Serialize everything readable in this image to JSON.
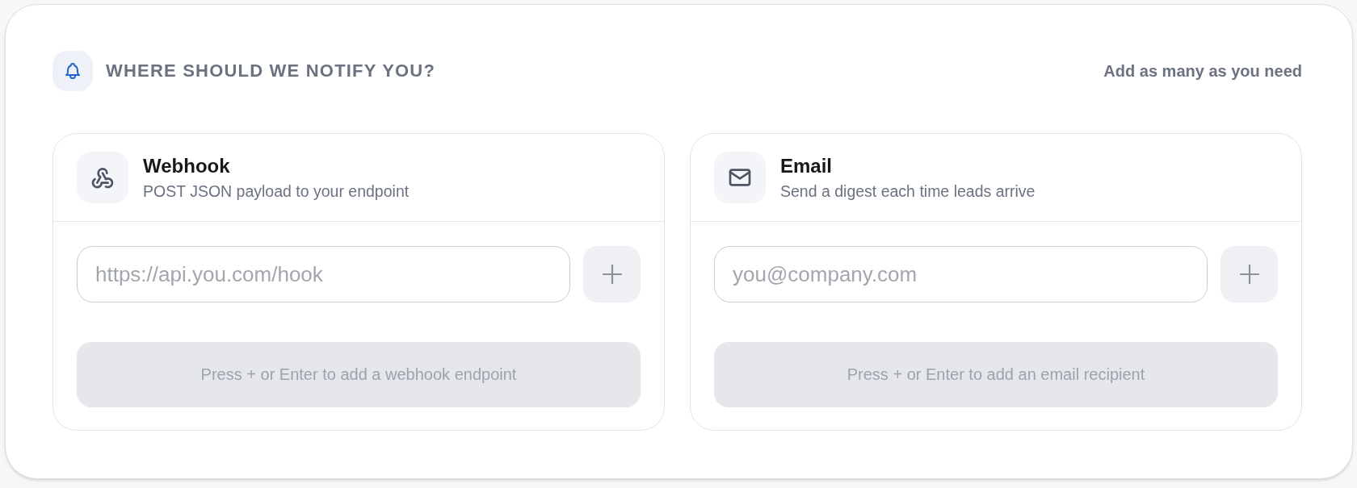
{
  "header": {
    "title": "WHERE SHOULD WE NOTIFY YOU?",
    "note": "Add as many as you need"
  },
  "channels": [
    {
      "kind": "webhook",
      "title": "Webhook",
      "subtitle": "POST JSON payload to your endpoint",
      "input": {
        "placeholder": "https://api.you.com/hook"
      },
      "empty_hint": "Press + or Enter to add a webhook endpoint"
    },
    {
      "kind": "email",
      "title": "Email",
      "subtitle": "Send a digest each time leads arrive",
      "input": {
        "placeholder": "you@company.com"
      },
      "empty_hint": "Press + or Enter to add an email recipient"
    }
  ]
}
